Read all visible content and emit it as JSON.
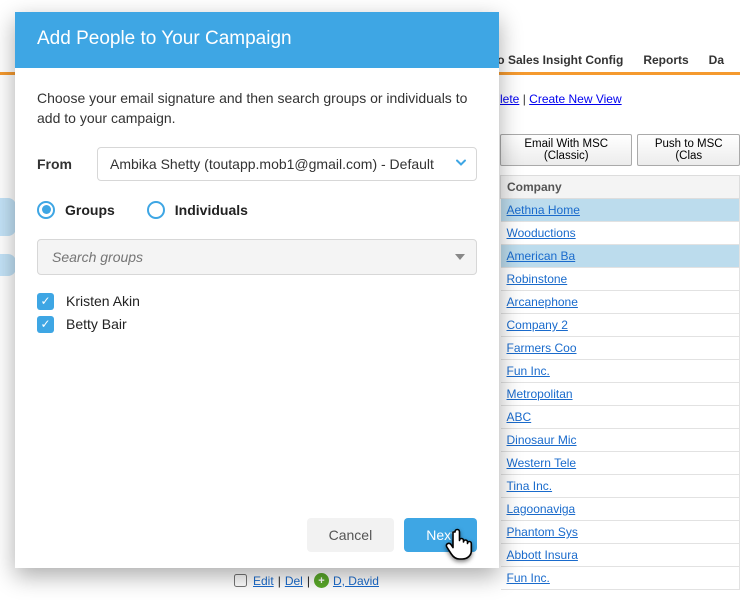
{
  "background": {
    "nav": {
      "sales_insight": "to Sales Insight Config",
      "reports": "Reports",
      "da": "Da"
    },
    "view": {
      "lete": "lete",
      "sep": " | ",
      "create": "Create New View"
    },
    "buttons": {
      "email": "Email With MSC (Classic)",
      "push": "Push to MSC (Clas"
    },
    "company_header": "Company",
    "companies": [
      {
        "name": "Aethna Home",
        "hl": true
      },
      {
        "name": "Wooductions",
        "hl": false
      },
      {
        "name": "American Ba",
        "hl": true
      },
      {
        "name": "Robinstone",
        "hl": false
      },
      {
        "name": "Arcanephone",
        "hl": false
      },
      {
        "name": "Company 2",
        "hl": false
      },
      {
        "name": "Farmers Coo",
        "hl": false
      },
      {
        "name": "Fun Inc.",
        "hl": false
      },
      {
        "name": "Metropolitan",
        "hl": false
      },
      {
        "name": "ABC",
        "hl": false
      },
      {
        "name": "Dinosaur Mic",
        "hl": false
      },
      {
        "name": "Western Tele",
        "hl": false
      },
      {
        "name": "Tina Inc.",
        "hl": false
      },
      {
        "name": "Lagoonaviga",
        "hl": false
      },
      {
        "name": "Phantom Sys",
        "hl": false
      },
      {
        "name": "Abbott Insura",
        "hl": false
      },
      {
        "name": "Fun Inc.",
        "hl": false
      }
    ],
    "editrow": {
      "edit": "Edit",
      "sep": " | ",
      "del": "Del",
      "pipe": " | ",
      "name": "D, David"
    }
  },
  "modal": {
    "title": "Add People to Your Campaign",
    "description": "Choose your email signature and then search groups or individuals to add to your campaign.",
    "from_label": "From",
    "from_value": "Ambika Shetty (toutapp.mob1@gmail.com) - Default",
    "radio_groups": "Groups",
    "radio_individuals": "Individuals",
    "search_placeholder": "Search groups",
    "people": [
      {
        "name": "Kristen Akin",
        "checked": true
      },
      {
        "name": "Betty Bair",
        "checked": true
      }
    ],
    "cancel": "Cancel",
    "next": "Next"
  }
}
